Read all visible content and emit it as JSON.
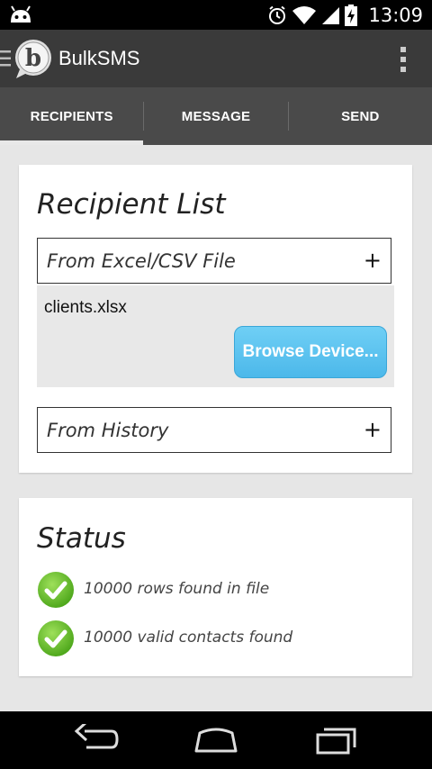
{
  "status_bar": {
    "time": "13:09",
    "icons": [
      "android-icon",
      "alarm-icon",
      "wifi-icon",
      "signal-icon",
      "battery-icon"
    ]
  },
  "app_bar": {
    "title": "BulkSMS",
    "icons": [
      "menu-icon",
      "app-logo",
      "overflow-menu-icon"
    ]
  },
  "tabs": [
    {
      "label": "RECIPIENTS",
      "active": true
    },
    {
      "label": "MESSAGE",
      "active": false
    },
    {
      "label": "SEND",
      "active": false
    }
  ],
  "recipient_card": {
    "title": "Recipient List",
    "excel_section": {
      "label": "From Excel/CSV File",
      "toggle": "+"
    },
    "file_name": "clients.xlsx",
    "browse_button": "Browse Device...",
    "history_section": {
      "label": "From History",
      "toggle": "+"
    }
  },
  "status_card": {
    "title": "Status",
    "items": [
      {
        "text": "10000 rows found in file",
        "icon": "check-icon"
      },
      {
        "text": "10000 valid contacts found",
        "icon": "check-icon"
      }
    ]
  },
  "colors": {
    "action_bar": "#3a3a3a",
    "tabs": "#4a4a4a",
    "button": "#4cb8ea",
    "check": "#6cc52c"
  }
}
